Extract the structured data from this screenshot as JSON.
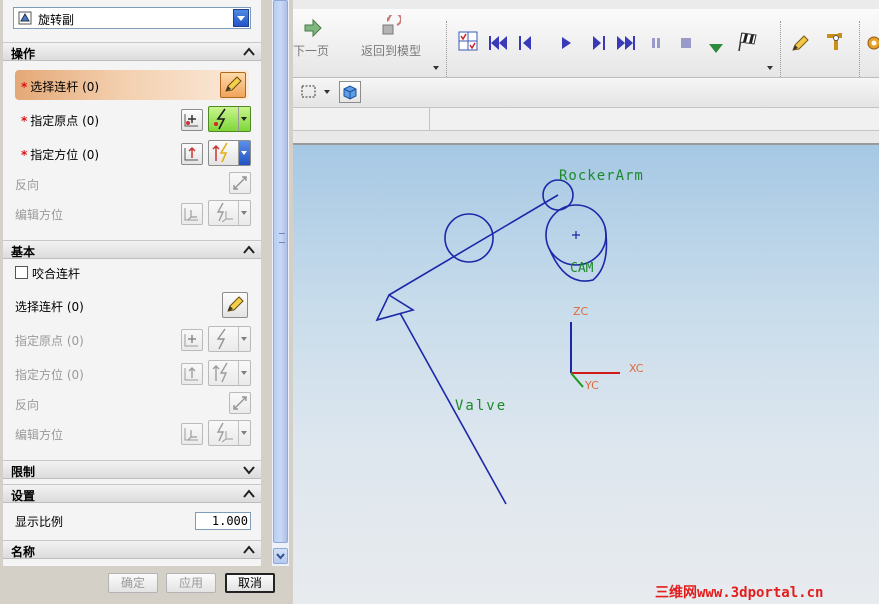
{
  "dialog": {
    "type_select": "旋转副",
    "buttons": {
      "ok": "确定",
      "apply": "应用",
      "cancel": "取消"
    }
  },
  "sections": {
    "operation": {
      "title": "操作",
      "rows": {
        "select_link": "选择连杆 (0)",
        "specify_origin": "指定原点 (0)",
        "specify_orientation": "指定方位 (0)",
        "reverse": "反向",
        "edit_orientation": "编辑方位"
      },
      "required_marker": "*"
    },
    "base": {
      "title": "基本",
      "snap_link": "咬合连杆",
      "rows": {
        "select_link": "选择连杆 (0)",
        "specify_origin": "指定原点 (0)",
        "specify_orientation": "指定方位 (0)",
        "reverse": "反向",
        "edit_orientation": "编辑方位"
      }
    },
    "limits": {
      "title": "限制"
    },
    "settings": {
      "title": "设置",
      "display_scale_label": "显示比例",
      "display_scale_value": "1.000"
    },
    "name": {
      "title": "名称"
    }
  },
  "toolbar": {
    "prev_page": "下一页",
    "back_to_model": "返回到模型"
  },
  "viewport": {
    "labels": {
      "rocker_arm": "RockerArm",
      "cam": "CAM",
      "valve": "Valve",
      "zc": "ZC",
      "xc": "XC",
      "yc": "YC"
    },
    "colors": {
      "geometry": "#1c28a8",
      "label": "#1c8a2a",
      "axis_label": "#e06a3a",
      "x_axis": "#d11b1b",
      "z_axis": "#1c28a8",
      "y_axis": "#1c9a1c"
    },
    "watermark": "三维网www.3dportal.cn"
  }
}
